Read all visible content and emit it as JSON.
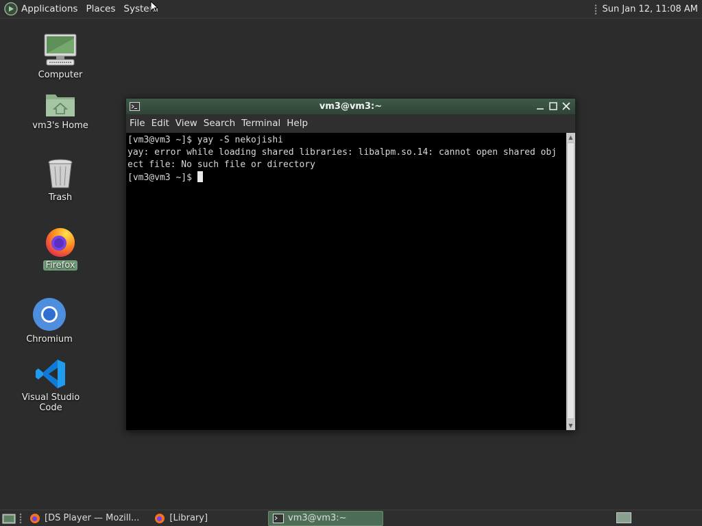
{
  "top_panel": {
    "menus": [
      "Applications",
      "Places",
      "System"
    ],
    "clock": "Sun Jan 12, 11:08 AM"
  },
  "desktop_icons": [
    {
      "label": "Computer",
      "icon": "computer-icon"
    },
    {
      "label": "vm3's Home",
      "icon": "home-folder-icon"
    },
    {
      "label": "Trash",
      "icon": "trash-icon"
    },
    {
      "label": "Firefox",
      "icon": "firefox-icon",
      "selected": true
    },
    {
      "label": "Chromium",
      "icon": "chromium-icon"
    },
    {
      "label": "Visual Studio Code",
      "icon": "vscode-icon"
    }
  ],
  "terminal": {
    "title": "vm3@vm3:~",
    "menus": [
      "File",
      "Edit",
      "View",
      "Search",
      "Terminal",
      "Help"
    ],
    "lines": [
      "[vm3@vm3 ~]$ yay -S nekojishi",
      "yay: error while loading shared libraries: libalpm.so.14: cannot open shared obj",
      "ect file: No such file or directory"
    ],
    "prompt": "[vm3@vm3 ~]$ "
  },
  "taskbar": {
    "tasks": [
      {
        "label": "[DS Player — Mozill...",
        "icon": "firefox-icon",
        "active": false
      },
      {
        "label": "[Library]",
        "icon": "firefox-icon",
        "active": false
      },
      {
        "label": "vm3@vm3:~",
        "icon": "terminal-icon",
        "active": true
      }
    ]
  },
  "colors": {
    "accent": "#6f9d78",
    "desktop_bg": "#2b2c2b",
    "terminal_bg": "#000000"
  }
}
